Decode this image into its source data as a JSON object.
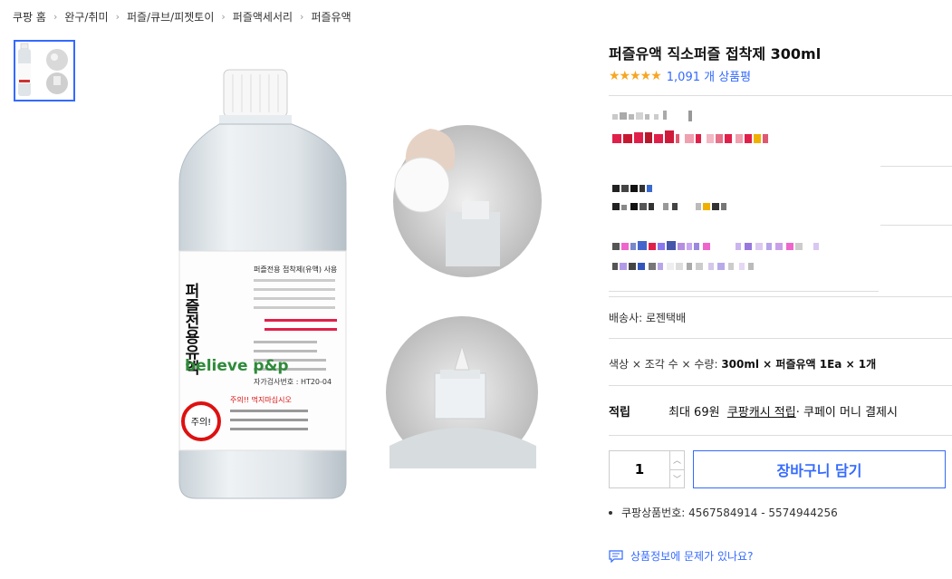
{
  "breadcrumb": [
    "쿠팡 홈",
    "완구/취미",
    "퍼즐/큐브/피젯토이",
    "퍼즐액세서리",
    "퍼즐유액"
  ],
  "product": {
    "title": "퍼즐유액 직소퍼즐 접착제 300ml",
    "review_count": "1,091 개 상품평",
    "rating_stars": "★★★★★",
    "image": {
      "label_heading": "퍼즐전용 접착제(유액) 사용",
      "label_vertical": "퍼즐전용유액",
      "brand": "believe p&p",
      "warning_badge": "주의!",
      "warning_title": "주의!! 먹지마십시오",
      "cert_prefix": "자가검사번호 : HT20-04"
    }
  },
  "seller": {
    "text": "배송사:  로젠택배"
  },
  "options": {
    "prefix": "색상 × 조각 수 × 수량: ",
    "value": "300ml × 퍼즐유액 1Ea × 1개"
  },
  "reward": {
    "label": "적립",
    "max": "최대 69원",
    "cash_link": "쿠팡캐시 적립",
    "suffix": " · 쿠페이 머니 결제시"
  },
  "quantity": {
    "value": "1"
  },
  "cart_button": "장바구니 담기",
  "product_number": "쿠팡상품번호: 4567584914 - 5574944256",
  "report_link": "상품정보에 문제가 있나요?",
  "colors": {
    "accent": "#346aff",
    "star": "#f5a623",
    "mosaic_red": "#e0204a"
  }
}
